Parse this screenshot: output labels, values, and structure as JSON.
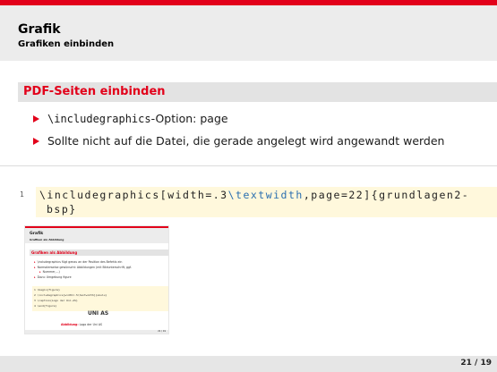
{
  "header": {
    "title": "Grafik",
    "subtitle": "Grafiken einbinden"
  },
  "block": {
    "title": "PDF-Seiten einbinden"
  },
  "bullets": [
    {
      "code": "\\includegraphics",
      "text": "-Option: page"
    },
    {
      "text": "Sollte nicht auf die Datei, die gerade angelegt wird angewandt werden"
    }
  ],
  "code": {
    "line_number": "1",
    "line1_prefix": "\\includegraphics[width=.3",
    "line1_kw": "\\textwidth",
    "line1_suffix": ",page=22]{grundlagen2-",
    "line2": "bsp}"
  },
  "thumbnail": {
    "title": "Grafik",
    "subtitle": "Grafiken als Abbildung",
    "block_title": "Grafiken als Abbildung",
    "bullets": [
      "\\includegraphics fügt genau an der Position des Befehls ein",
      "Normalerweise gewünscht: Abbildungen (mit Bildunterschrift, ggf.",
      "Nummer,...)",
      "Dazu: Umgebung figure"
    ],
    "code_lines": [
      "1 \\begin{figure}",
      "2 \\includegraphics[width=.5\\textwidth]{ukulu}",
      "3 \\caption{Logo der Uni-AS}",
      "4 \\end{figure}"
    ],
    "logo_text": "UNI AS",
    "caption_label": "Abbildung:",
    "caption_text": "Logo der Uni AS",
    "page": "21 / 19"
  },
  "footer": {
    "page": "21 / 19"
  },
  "colors": {
    "accent": "#e2001a",
    "header_bg": "#ececec",
    "code_bg": "#fff8dc"
  }
}
